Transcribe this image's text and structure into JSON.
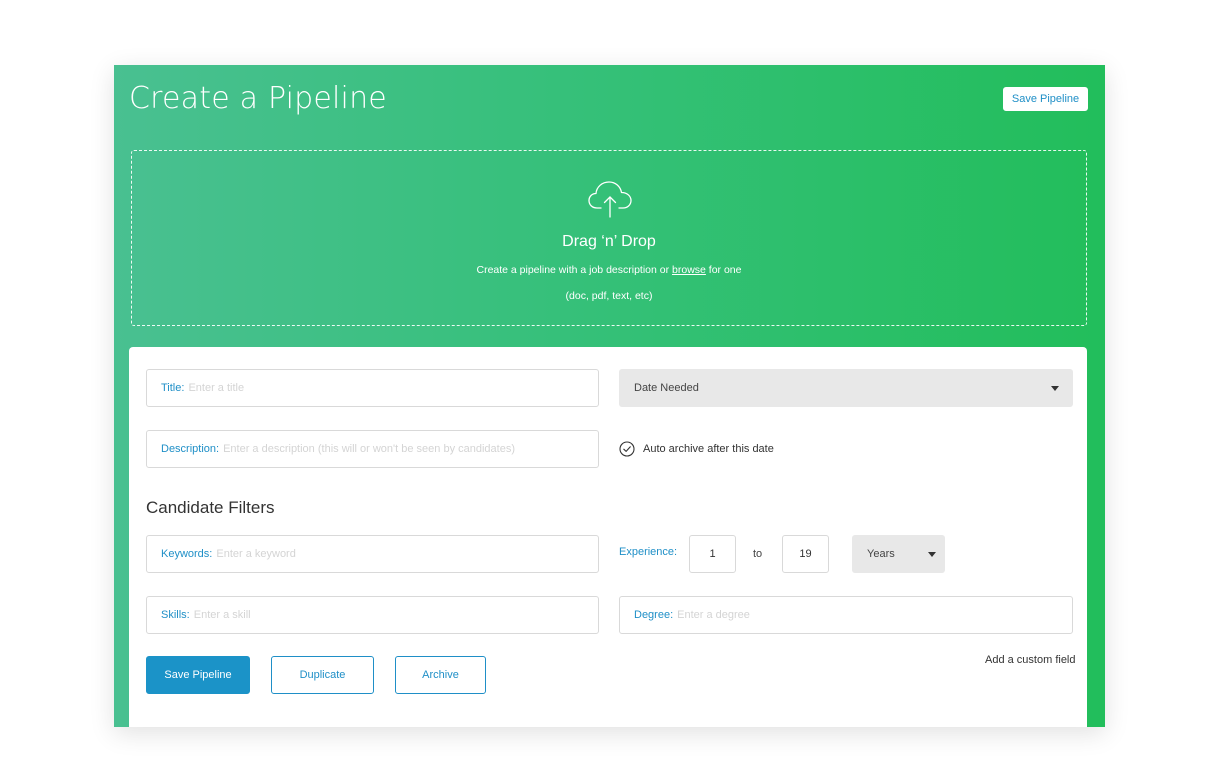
{
  "header": {
    "title": "Create a Pipeline",
    "save_label": "Save Pipeline"
  },
  "dropzone": {
    "icon": "cloud-upload-icon",
    "title": "Drag ‘n’ Drop",
    "subtitle_before": "Create a pipeline with a job description or",
    "browse_link": "browse",
    "subtitle_after": "for one",
    "file_types": "(doc, pdf, text, etc)"
  },
  "form": {
    "title": {
      "label": "Title:",
      "placeholder": "Enter a title"
    },
    "date_needed": {
      "value": "Date Needed"
    },
    "description": {
      "label": "Description:",
      "placeholder": "Enter a description (this will or won't be seen by candidates)"
    },
    "auto_archive": {
      "label": "Auto archive after this date",
      "checked": true
    },
    "filters_heading": "Candidate Filters",
    "keywords": {
      "label": "Keywords:",
      "placeholder": "Enter a keyword"
    },
    "experience": {
      "label": "Experience:",
      "min": "1",
      "to_label": "to",
      "max": "19",
      "unit": "Years"
    },
    "skills": {
      "label": "Skills:",
      "placeholder": "Enter a skill"
    },
    "degree": {
      "label": "Degree:",
      "placeholder": "Enter a degree"
    }
  },
  "actions": {
    "save_label": "Save Pipeline",
    "duplicate_label": "Duplicate",
    "archive_label": "Archive",
    "custom_field_label": "Add a custom field"
  },
  "colors": {
    "accent": "#1b93c8",
    "gradient_start": "#49c091",
    "gradient_end": "#22be5b"
  }
}
